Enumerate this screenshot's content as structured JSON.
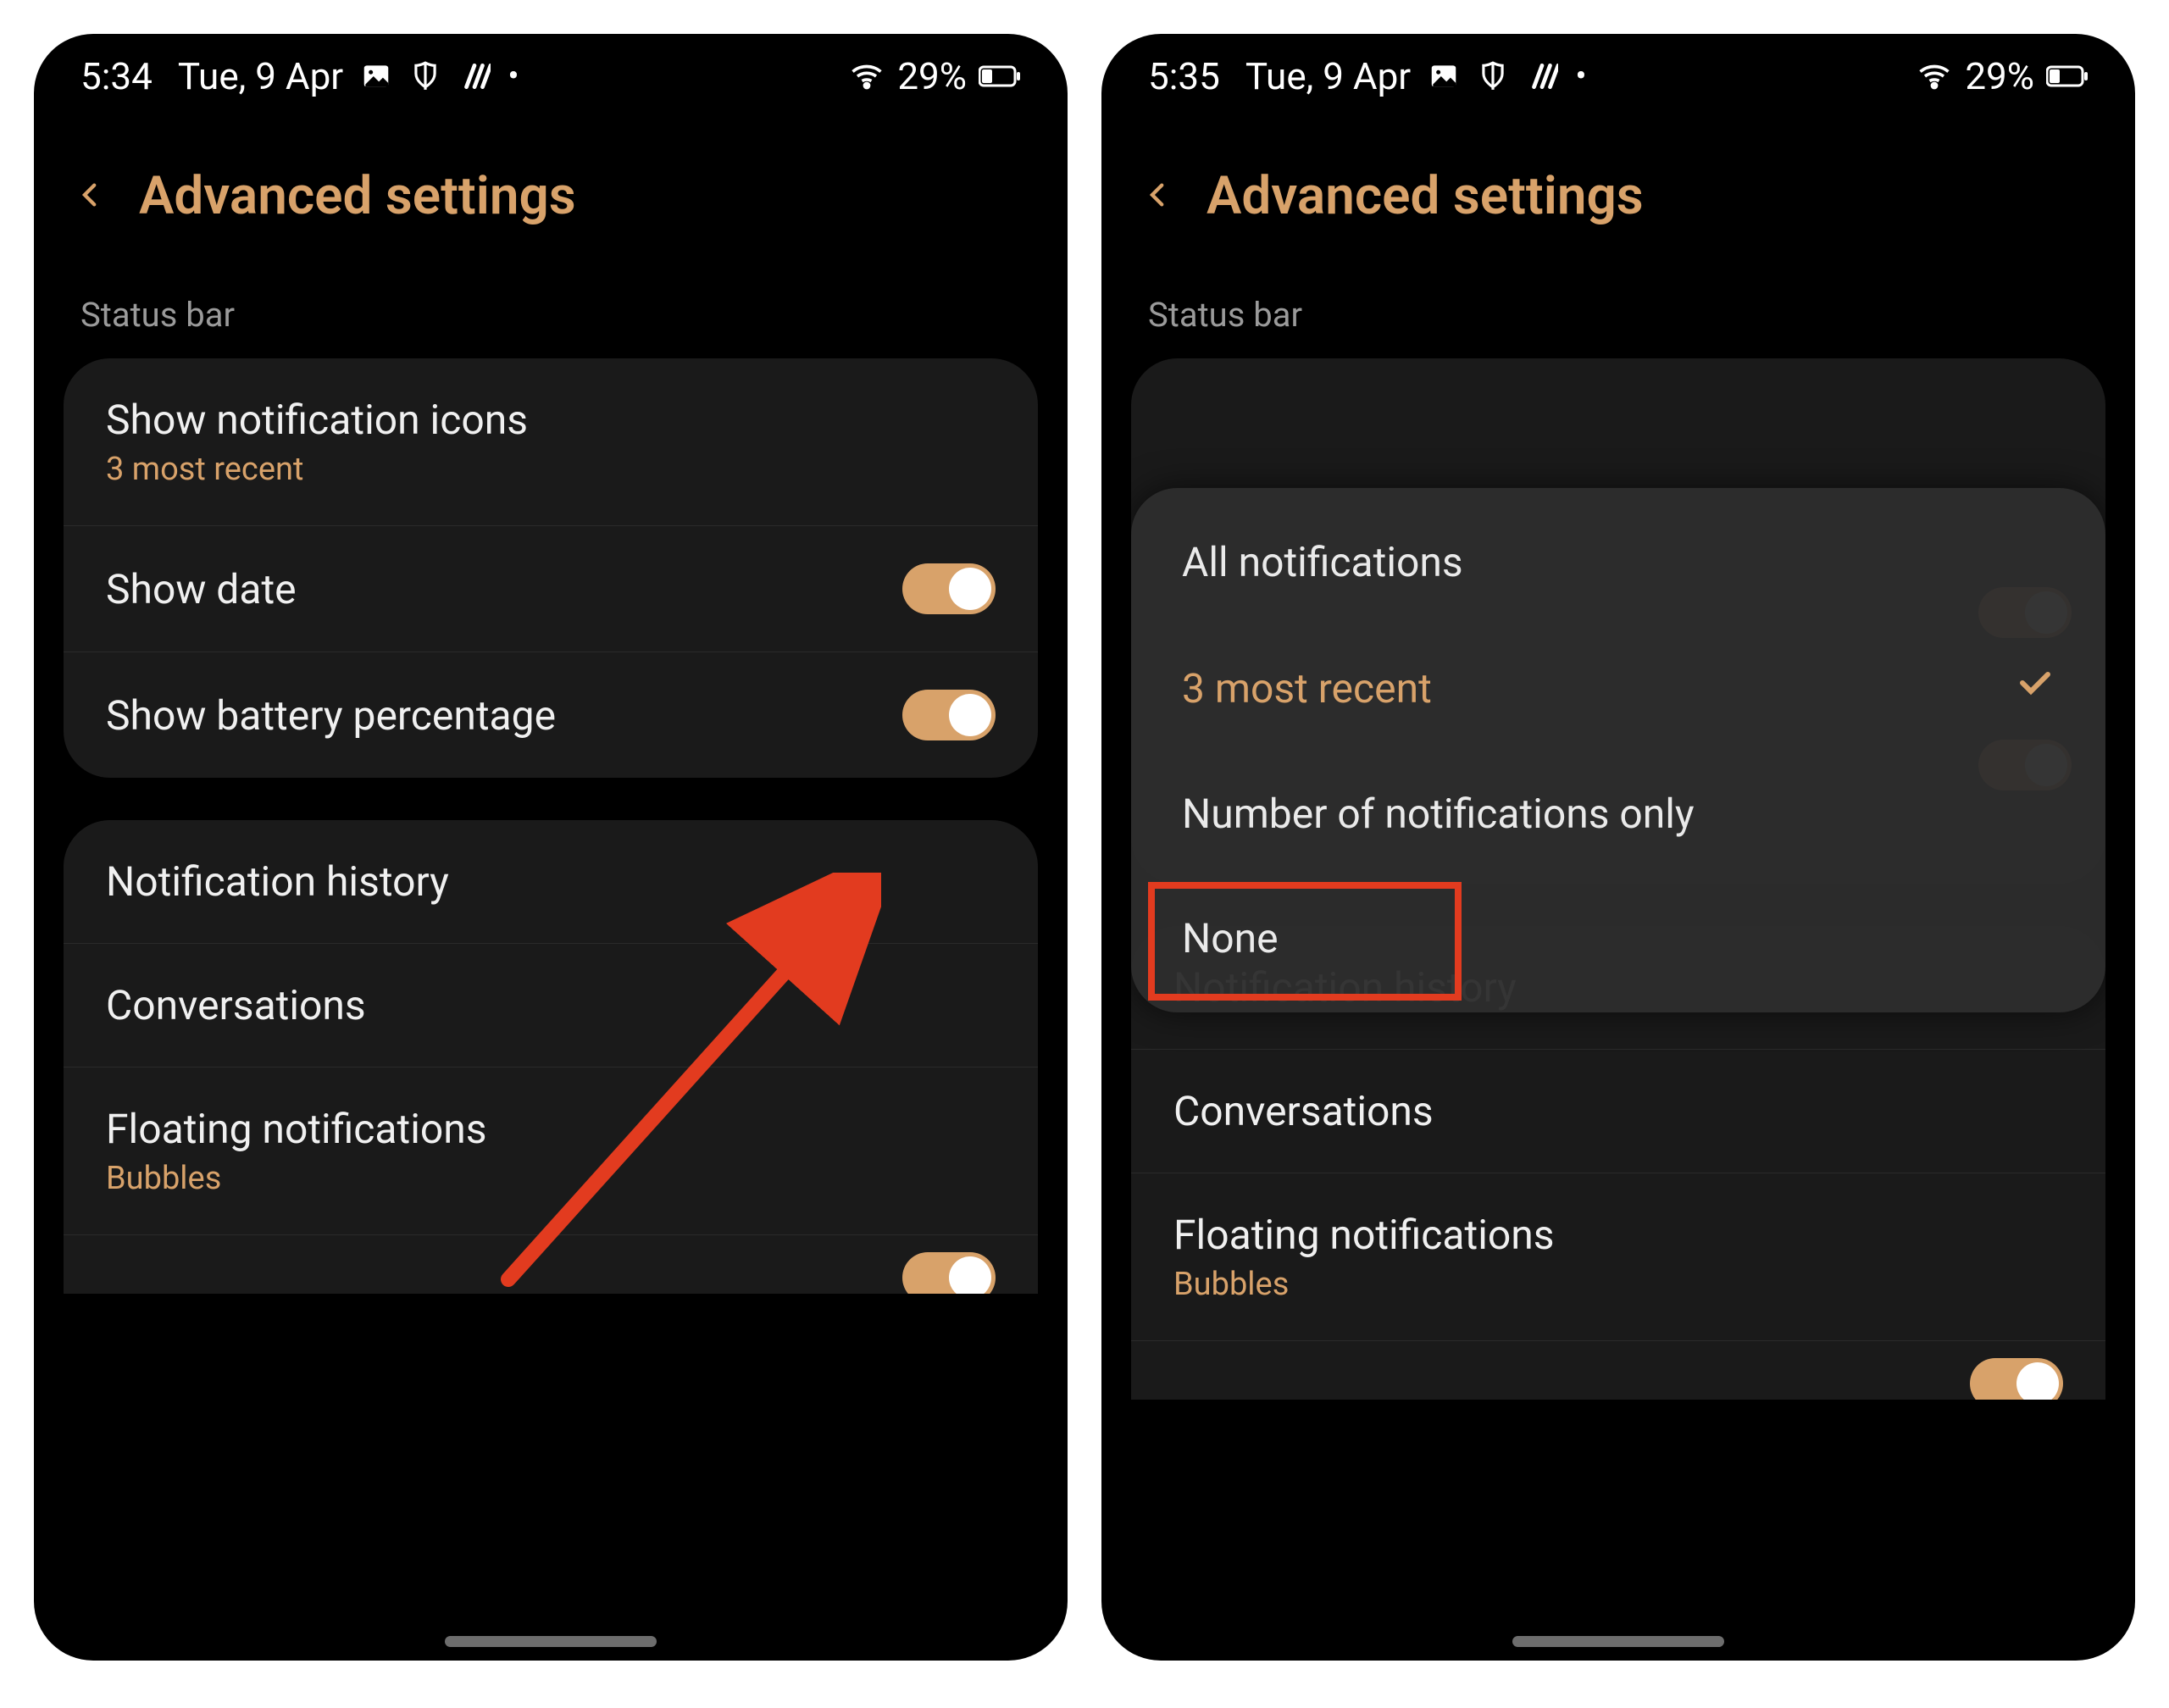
{
  "colors": {
    "accent": "#d8a26a",
    "highlight": "#e23b1f"
  },
  "left": {
    "status": {
      "time": "5:34",
      "date": "Tue, 9 Apr",
      "battery": "29%",
      "icons": [
        "image-icon",
        "shield-icon",
        "stripes-icon",
        "dot-icon"
      ]
    },
    "title": "Advanced settings",
    "section": "Status bar",
    "rows1": [
      {
        "title": "Show notification icons",
        "sub": "3 most recent"
      },
      {
        "title": "Show date",
        "toggle": true
      },
      {
        "title": "Show battery percentage",
        "toggle": true
      }
    ],
    "rows2": [
      {
        "title": "Notification history"
      },
      {
        "title": "Conversations"
      },
      {
        "title": "Floating notifications",
        "sub": "Bubbles"
      }
    ]
  },
  "right": {
    "status": {
      "time": "5:35",
      "date": "Tue, 9 Apr",
      "battery": "29%",
      "icons": [
        "image-icon",
        "shield-icon",
        "stripes-icon",
        "dot-icon"
      ]
    },
    "title": "Advanced settings",
    "section": "Status bar",
    "popup": {
      "options": [
        "All notifications",
        "3 most recent",
        "Number of notifications only",
        "None"
      ],
      "selected_index": 1,
      "highlighted_index": 3
    },
    "rows2": [
      {
        "title": "Notification history"
      },
      {
        "title": "Conversations"
      },
      {
        "title": "Floating notifications",
        "sub": "Bubbles"
      }
    ],
    "peek_toggles": [
      true,
      true
    ]
  }
}
